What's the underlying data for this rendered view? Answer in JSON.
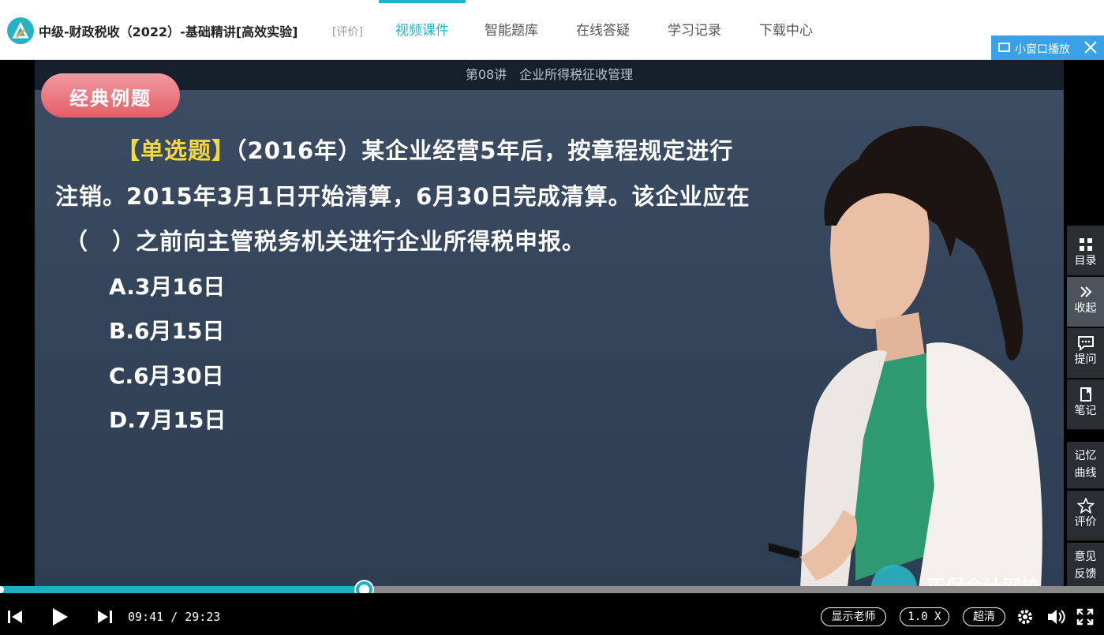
{
  "header": {
    "course_title": "中级-财政税收（2022）-基础精讲[高效实验]",
    "rate_link": "[评价]",
    "tabs": [
      {
        "label": "视频课件",
        "active": true
      },
      {
        "label": "智能题库",
        "active": false
      },
      {
        "label": "在线答疑",
        "active": false
      },
      {
        "label": "学习记录",
        "active": false
      },
      {
        "label": "下载中心",
        "active": false
      }
    ],
    "mini_window_label": "小窗口播放",
    "accent_color": "#1eb5c4"
  },
  "video": {
    "lesson_title": "第08讲　企业所得税征收管理",
    "badge": "经典例题",
    "question": {
      "tag": "【单选题】",
      "line1_rest": "（2016年）某企业经营5年后，按章程规定进行",
      "line2": "注销。2015年3月1日开始清算，6月30日完成清算。该企业应在",
      "line3": "（　）之前向主管税务机关进行企业所得税申报。"
    },
    "options": [
      "A.3月16日",
      "B.6月15日",
      "C.6月30日",
      "D.7月15日"
    ],
    "watermark_text": "正保会计网校"
  },
  "side_panel": [
    {
      "icon": "grid-icon",
      "label": "目录"
    },
    {
      "icon": "double-chevron-right-icon",
      "label": "收起"
    },
    {
      "icon": "chat-bubble-icon",
      "label": "提问"
    },
    {
      "icon": "notebook-icon",
      "label": "笔记"
    },
    {
      "icon": "",
      "label": "记忆曲线",
      "label_lines": [
        "记忆",
        "曲线"
      ]
    },
    {
      "icon": "star-icon",
      "label": "评价"
    },
    {
      "icon": "",
      "label": "意见反馈",
      "label_lines": [
        "意见",
        "反馈"
      ]
    }
  ],
  "player": {
    "current_time": "09:41",
    "separator": "/",
    "total_time": "29:23",
    "progress_fraction": 0.3295,
    "show_teacher_label": "显示老师",
    "speed_label": "1.0 X",
    "quality_label": "超清"
  }
}
